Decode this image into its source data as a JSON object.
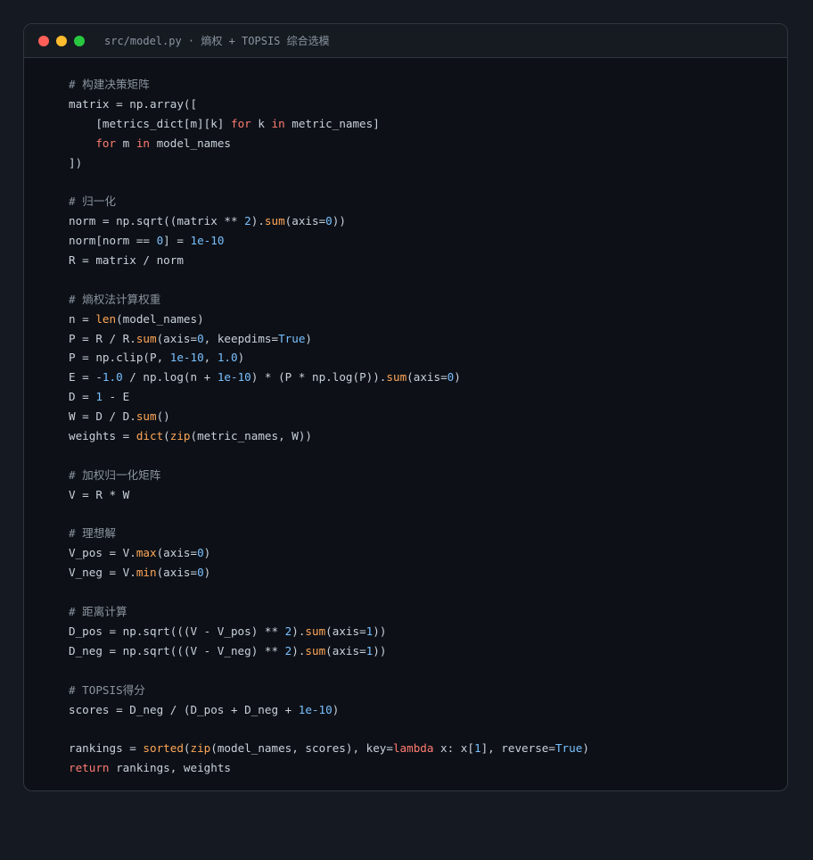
{
  "window": {
    "title": "src/model.py · 熵权 + TOPSIS 综合选模",
    "dots": [
      {
        "name": "close-dot",
        "color": "#ff5f57"
      },
      {
        "name": "minimize-dot",
        "color": "#febc2e"
      },
      {
        "name": "maximize-dot",
        "color": "#28c840"
      }
    ]
  },
  "colors": {
    "background": "#151a22",
    "editor": "#0d1117",
    "keyword": "#ff7b72",
    "function": "#ffa657",
    "number": "#79c0ff",
    "comment": "#8b949e",
    "text": "#c9d1d9"
  },
  "code_lines": [
    [
      [
        "com",
        "# 构建决策矩阵"
      ]
    ],
    [
      [
        "plain",
        "matrix = np.array(["
      ]
    ],
    [
      [
        "plain",
        "    [metrics_dict[m][k] "
      ],
      [
        "kw",
        "for"
      ],
      [
        "plain",
        " k "
      ],
      [
        "kw",
        "in"
      ],
      [
        "plain",
        " metric_names]"
      ]
    ],
    [
      [
        "plain",
        "    "
      ],
      [
        "kw",
        "for"
      ],
      [
        "plain",
        " m "
      ],
      [
        "kw",
        "in"
      ],
      [
        "plain",
        " model_names"
      ]
    ],
    [
      [
        "plain",
        "])"
      ]
    ],
    [],
    [
      [
        "com",
        "# 归一化"
      ]
    ],
    [
      [
        "plain",
        "norm = np.sqrt((matrix ** "
      ],
      [
        "num",
        "2"
      ],
      [
        "plain",
        ")."
      ],
      [
        "fn",
        "sum"
      ],
      [
        "plain",
        "(axis="
      ],
      [
        "num",
        "0"
      ],
      [
        "plain",
        "))"
      ]
    ],
    [
      [
        "plain",
        "norm[norm == "
      ],
      [
        "num",
        "0"
      ],
      [
        "plain",
        "] = "
      ],
      [
        "num",
        "1e-10"
      ]
    ],
    [
      [
        "plain",
        "R = matrix / norm"
      ]
    ],
    [],
    [
      [
        "com",
        "# 熵权法计算权重"
      ]
    ],
    [
      [
        "plain",
        "n = "
      ],
      [
        "fn",
        "len"
      ],
      [
        "plain",
        "(model_names)"
      ]
    ],
    [
      [
        "plain",
        "P = R / R."
      ],
      [
        "fn",
        "sum"
      ],
      [
        "plain",
        "(axis="
      ],
      [
        "num",
        "0"
      ],
      [
        "plain",
        ", keepdims="
      ],
      [
        "num",
        "True"
      ],
      [
        "plain",
        ")"
      ]
    ],
    [
      [
        "plain",
        "P = np.clip(P, "
      ],
      [
        "num",
        "1e-10"
      ],
      [
        "plain",
        ", "
      ],
      [
        "num",
        "1.0"
      ],
      [
        "plain",
        ")"
      ]
    ],
    [
      [
        "plain",
        "E = -"
      ],
      [
        "num",
        "1.0"
      ],
      [
        "plain",
        " / np.log(n + "
      ],
      [
        "num",
        "1e-10"
      ],
      [
        "plain",
        ") * (P * np.log(P))."
      ],
      [
        "fn",
        "sum"
      ],
      [
        "plain",
        "(axis="
      ],
      [
        "num",
        "0"
      ],
      [
        "plain",
        ")"
      ]
    ],
    [
      [
        "plain",
        "D = "
      ],
      [
        "num",
        "1"
      ],
      [
        "plain",
        " - E"
      ]
    ],
    [
      [
        "plain",
        "W = D / D."
      ],
      [
        "fn",
        "sum"
      ],
      [
        "plain",
        "()"
      ]
    ],
    [
      [
        "plain",
        "weights = "
      ],
      [
        "fn",
        "dict"
      ],
      [
        "plain",
        "("
      ],
      [
        "fn",
        "zip"
      ],
      [
        "plain",
        "(metric_names, W))"
      ]
    ],
    [],
    [
      [
        "com",
        "# 加权归一化矩阵"
      ]
    ],
    [
      [
        "plain",
        "V = R * W"
      ]
    ],
    [],
    [
      [
        "com",
        "# 理想解"
      ]
    ],
    [
      [
        "plain",
        "V_pos = V."
      ],
      [
        "fn",
        "max"
      ],
      [
        "plain",
        "(axis="
      ],
      [
        "num",
        "0"
      ],
      [
        "plain",
        ")"
      ]
    ],
    [
      [
        "plain",
        "V_neg = V."
      ],
      [
        "fn",
        "min"
      ],
      [
        "plain",
        "(axis="
      ],
      [
        "num",
        "0"
      ],
      [
        "plain",
        ")"
      ]
    ],
    [],
    [
      [
        "com",
        "# 距离计算"
      ]
    ],
    [
      [
        "plain",
        "D_pos = np.sqrt(((V - V_pos) ** "
      ],
      [
        "num",
        "2"
      ],
      [
        "plain",
        ")."
      ],
      [
        "fn",
        "sum"
      ],
      [
        "plain",
        "(axis="
      ],
      [
        "num",
        "1"
      ],
      [
        "plain",
        "))"
      ]
    ],
    [
      [
        "plain",
        "D_neg = np.sqrt(((V - V_neg) ** "
      ],
      [
        "num",
        "2"
      ],
      [
        "plain",
        ")."
      ],
      [
        "fn",
        "sum"
      ],
      [
        "plain",
        "(axis="
      ],
      [
        "num",
        "1"
      ],
      [
        "plain",
        "))"
      ]
    ],
    [],
    [
      [
        "com",
        "# TOPSIS得分"
      ]
    ],
    [
      [
        "plain",
        "scores = D_neg / (D_pos + D_neg + "
      ],
      [
        "num",
        "1e-10"
      ],
      [
        "plain",
        ")"
      ]
    ],
    [],
    [
      [
        "plain",
        "rankings = "
      ],
      [
        "fn",
        "sorted"
      ],
      [
        "plain",
        "("
      ],
      [
        "fn",
        "zip"
      ],
      [
        "plain",
        "(model_names, scores), key="
      ],
      [
        "kw",
        "lambda"
      ],
      [
        "plain",
        " x: x["
      ],
      [
        "num",
        "1"
      ],
      [
        "plain",
        "], reverse="
      ],
      [
        "num",
        "True"
      ],
      [
        "plain",
        ")"
      ]
    ],
    [
      [
        "kw",
        "return"
      ],
      [
        "plain",
        " rankings, weights"
      ]
    ]
  ]
}
